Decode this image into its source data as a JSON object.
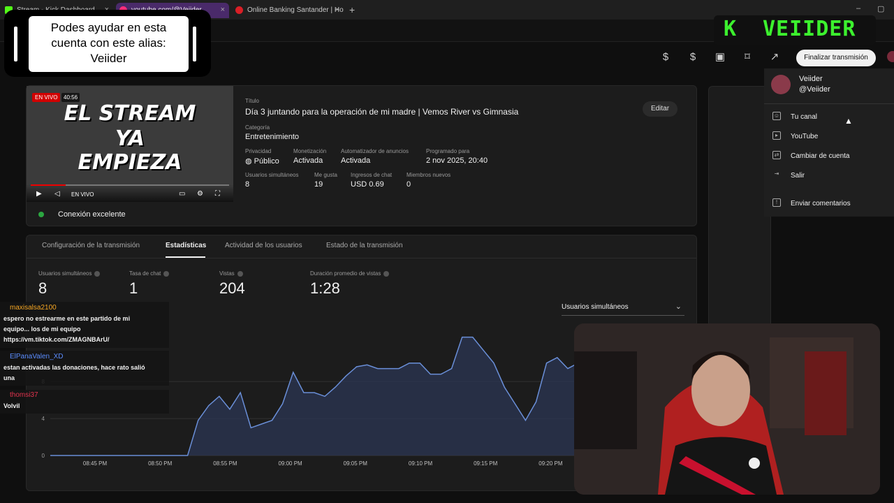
{
  "browser": {
    "tabs": [
      {
        "label": "Stream - Kick Dashboard",
        "color": "#53fc18"
      },
      {
        "label": "youtube.com/@Veiider",
        "color": "#ff2d7a"
      },
      {
        "label": "Online Banking Santander | Ho",
        "color": "#d91f26"
      }
    ],
    "close_glyph": "×",
    "new_tab_glyph": "+"
  },
  "header": {
    "finish_label": "Finalizar transmisión",
    "icons": [
      "monetize-icon",
      "dollar-icon",
      "clapper-icon",
      "bookmark-icon",
      "share-icon"
    ]
  },
  "stream": {
    "thumb_line1": "EL STREAM",
    "thumb_line2": "YA",
    "thumb_line3": "EMPIEZA",
    "live_badge": "EN VIVO",
    "time_badge": "40:56",
    "player_live": "EN VIVO",
    "title_label": "Título",
    "title": "Día 3 juntando para la operación de mi madre | Vemos River vs Gimnasia",
    "edit_label": "Editar",
    "category_label": "Categoría",
    "category": "Entretenimiento",
    "fields": [
      {
        "label": "Privacidad",
        "value": "Público"
      },
      {
        "label": "Monetización",
        "value": "Activada"
      },
      {
        "label": "Automatizador de anuncios",
        "value": "Activada"
      },
      {
        "label": "Programado para",
        "value": "2 nov 2025, 20:40"
      }
    ],
    "fields2": [
      {
        "label": "Usuarios simultáneos",
        "value": "8"
      },
      {
        "label": "Me gusta",
        "value": "19"
      },
      {
        "label": "Ingresos de chat",
        "value": "USD 0.69"
      },
      {
        "label": "Miembros nuevos",
        "value": "0"
      }
    ],
    "connection": "Conexión excelente"
  },
  "tabs": [
    "Configuración de la transmisión",
    "Estadísticas",
    "Actividad de los usuarios",
    "Estado de la transmisión"
  ],
  "stats": [
    {
      "label": "Usuarios simultáneos",
      "value": "8"
    },
    {
      "label": "Tasa de chat",
      "value": "1"
    },
    {
      "label": "Vistas",
      "value": "204"
    },
    {
      "label": "Duración promedio de vistas",
      "value": "1:28"
    }
  ],
  "dropdown": {
    "label": "Usuarios simultáneos",
    "chevron": "⌄"
  },
  "chart_data": {
    "type": "area",
    "x": [
      "08:45 PM",
      "08:50 PM",
      "08:55 PM",
      "09:00 PM",
      "09:05 PM",
      "09:10 PM",
      "09:15 PM",
      "09:20 PM"
    ],
    "yticks": [
      0,
      4,
      8
    ],
    "series": [
      {
        "values": [
          0,
          0,
          0,
          0,
          0,
          0,
          0,
          0,
          0,
          0,
          0,
          0,
          0,
          0,
          3.8,
          5.4,
          6.4,
          5.0,
          6.8,
          3.0,
          3.4,
          3.8,
          5.6,
          9.0,
          6.8,
          6.8,
          6.4,
          7.4,
          8.6,
          9.6,
          9.8,
          9.4,
          9.4,
          9.4,
          10.0,
          10.0,
          8.8,
          8.8,
          9.4,
          12.8,
          12.8,
          11.4,
          10.0,
          7.4,
          5.6,
          3.8,
          5.8,
          10.0,
          10.6,
          9.4,
          10.0
        ],
        "color": "#6a8fd8"
      }
    ],
    "ylim": [
      0,
      13
    ]
  },
  "account_menu": {
    "name": "Veiider",
    "handle": "@Veiider",
    "items": [
      "Tu canal",
      "YouTube",
      "Cambiar de cuenta",
      "Salir",
      "Enviar comentarios"
    ]
  },
  "overlay": {
    "alias_text_1": "Podes ayudar en esta",
    "alias_text_2": "cuenta con este alias:",
    "alias_text_3": "Veiider",
    "logo_k": "K",
    "logo_text": "VEIIDER"
  },
  "chat": [
    {
      "user": "maxisalsa2100",
      "color": "#f5a623",
      "lines": [
        "espero no estrearme en este partido de mi",
        "equipo... los de mi equipo",
        "https://vm.tiktok.com/ZMAGNBArU/"
      ]
    },
    {
      "user": "ElPanaValen_XD",
      "color": "#5b8dff",
      "lines": [
        "estan activadas las donaciones, hace rato salió",
        "una"
      ]
    },
    {
      "user": "thomsi37",
      "color": "#e2334e",
      "lines": [
        "Volvil"
      ]
    }
  ]
}
